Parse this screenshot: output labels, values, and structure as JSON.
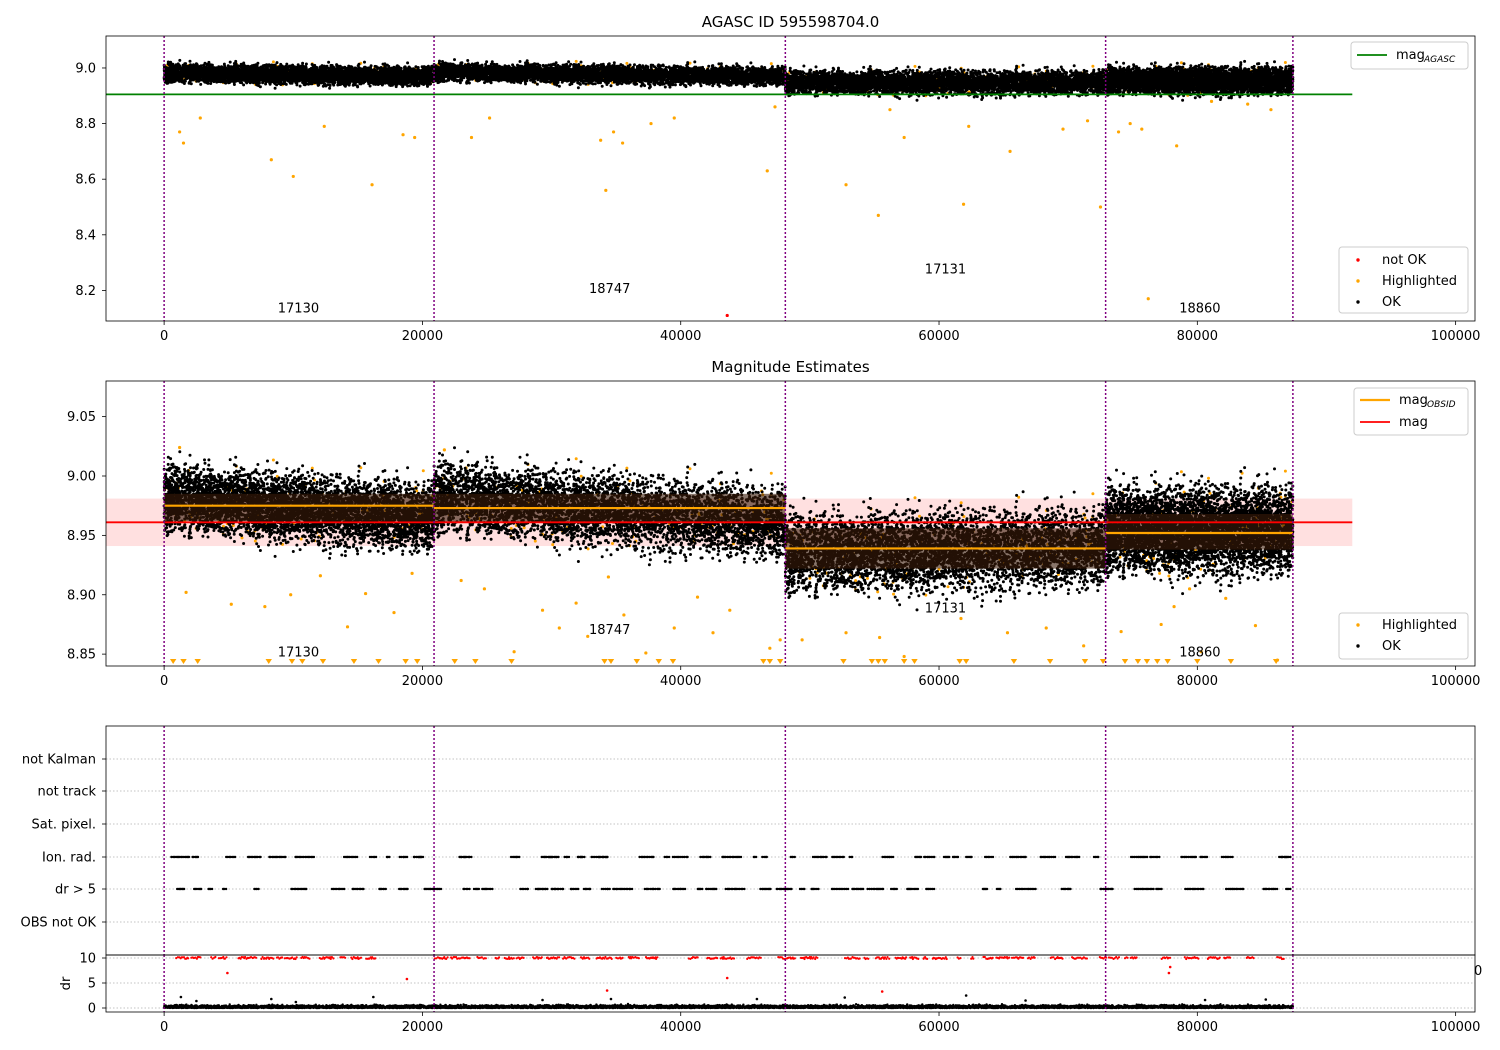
{
  "chart_data": [
    {
      "type": "scatter",
      "title": "AGASC ID 595598704.0",
      "xlim": [
        -4500,
        101500
      ],
      "ylim": [
        8.09,
        9.115
      ],
      "x_ticks": [
        0,
        20000,
        40000,
        60000,
        80000,
        100000
      ],
      "x_tick_labels": [
        "0",
        "20000",
        "40000",
        "60000",
        "80000",
        "100000"
      ],
      "y_ticks": [
        8.2,
        8.4,
        8.6,
        8.8,
        9.0
      ],
      "y_tick_labels": [
        "8.2",
        "8.4",
        "8.6",
        "8.8",
        "9.0"
      ],
      "obsid_boundaries": [
        0,
        20900,
        48100,
        72900,
        87400
      ],
      "obsid_labels": [
        {
          "text": "17130",
          "x": 10400,
          "y": 8.12
        },
        {
          "text": "18747",
          "x": 34500,
          "y": 8.19
        },
        {
          "text": "17131",
          "x": 60500,
          "y": 8.26
        },
        {
          "text": "18860",
          "x": 80200,
          "y": 8.12
        }
      ],
      "mag_agasc": 8.905,
      "mag_agasc_range": [
        -4500,
        92000
      ],
      "series_ok": [
        {
          "x": [
            0,
            20900
          ],
          "center": [
            8.982,
            8.97
          ],
          "spread": 0.035
        },
        {
          "x": [
            20900,
            48100
          ],
          "center": [
            8.985,
            8.97
          ],
          "spread": 0.035
        },
        {
          "x": [
            48100,
            72900
          ],
          "center": [
            8.948,
            8.948
          ],
          "spread": 0.045
        },
        {
          "x": [
            72900,
            87400
          ],
          "center": [
            8.955,
            8.955
          ],
          "spread": 0.05
        }
      ],
      "highlighted_outliers": [
        [
          1200,
          8.77
        ],
        [
          1500,
          8.73
        ],
        [
          2800,
          8.82
        ],
        [
          8300,
          8.67
        ],
        [
          10000,
          8.61
        ],
        [
          12400,
          8.79
        ],
        [
          16100,
          8.58
        ],
        [
          18500,
          8.76
        ],
        [
          19400,
          8.75
        ],
        [
          23800,
          8.75
        ],
        [
          25200,
          8.82
        ],
        [
          33800,
          8.74
        ],
        [
          34200,
          8.56
        ],
        [
          34800,
          8.77
        ],
        [
          35500,
          8.73
        ],
        [
          37700,
          8.8
        ],
        [
          39500,
          8.82
        ],
        [
          46700,
          8.63
        ],
        [
          47300,
          8.86
        ],
        [
          52800,
          8.58
        ],
        [
          55300,
          8.47
        ],
        [
          56200,
          8.85
        ],
        [
          57300,
          8.75
        ],
        [
          61900,
          8.51
        ],
        [
          62300,
          8.79
        ],
        [
          65500,
          8.7
        ],
        [
          69600,
          8.78
        ],
        [
          71500,
          8.81
        ],
        [
          72500,
          8.5
        ],
        [
          73900,
          8.77
        ],
        [
          74800,
          8.8
        ],
        [
          75700,
          8.78
        ],
        [
          76200,
          8.17
        ],
        [
          78400,
          8.72
        ],
        [
          81100,
          8.88
        ],
        [
          83900,
          8.87
        ],
        [
          85700,
          8.85
        ]
      ],
      "not_ok_points": [
        [
          43600,
          8.11
        ]
      ],
      "legend_top": [
        {
          "label_main": "mag",
          "label_sub": "AGASC",
          "color": "#008000"
        }
      ],
      "legend_bottom": [
        {
          "label": "not OK",
          "color": "#ff0000"
        },
        {
          "label": "Highlighted",
          "color": "#ffa500"
        },
        {
          "label": "OK",
          "color": "#000000"
        }
      ],
      "legend_position": "top-right / bottom-right"
    },
    {
      "type": "scatter",
      "title": "Magnitude Estimates",
      "xlim": [
        -4500,
        101500
      ],
      "ylim": [
        8.84,
        9.08
      ],
      "x_ticks": [
        0,
        20000,
        40000,
        60000,
        80000,
        100000
      ],
      "x_tick_labels": [
        "0",
        "20000",
        "40000",
        "60000",
        "80000",
        "100000"
      ],
      "y_ticks": [
        8.85,
        8.9,
        8.95,
        9.0,
        9.05
      ],
      "y_tick_labels": [
        "8.85",
        "8.90",
        "8.95",
        "9.00",
        "9.05"
      ],
      "obsid_boundaries": [
        0,
        20900,
        48100,
        72900,
        87400
      ],
      "obsid_labels": [
        {
          "text": "17130",
          "x": 10400,
          "y": 8.848
        },
        {
          "text": "18747",
          "x": 34500,
          "y": 8.867
        },
        {
          "text": "17131",
          "x": 60500,
          "y": 8.885
        },
        {
          "text": "18860",
          "x": 80200,
          "y": 8.848
        }
      ],
      "mag": 8.961,
      "mag_band": [
        8.941,
        8.981
      ],
      "mag_range": [
        -4500,
        92000
      ],
      "mag_obsid": [
        {
          "x": [
            0,
            20900
          ],
          "value": 8.975,
          "band": [
            8.962,
            8.985
          ]
        },
        {
          "x": [
            20900,
            48100
          ],
          "value": 8.973,
          "band": [
            8.961,
            8.985
          ]
        },
        {
          "x": [
            48100,
            72900
          ],
          "value": 8.939,
          "band": [
            8.922,
            8.956
          ]
        },
        {
          "x": [
            72900,
            87400
          ],
          "value": 8.952,
          "band": [
            8.938,
            8.968
          ]
        }
      ],
      "series_ok": [
        {
          "x": [
            0,
            20900
          ],
          "center": [
            8.982,
            8.965
          ],
          "spread": 0.03
        },
        {
          "x": [
            20900,
            48100
          ],
          "center": [
            8.983,
            8.96
          ],
          "spread": 0.032
        },
        {
          "x": [
            48100,
            72900
          ],
          "center": [
            8.935,
            8.94
          ],
          "spread": 0.035
        },
        {
          "x": [
            72900,
            87400
          ],
          "center": [
            8.955,
            8.955
          ],
          "spread": 0.038
        }
      ],
      "highlighted_outliers": [
        [
          1200,
          9.024
        ],
        [
          1700,
          8.902
        ],
        [
          5200,
          8.892
        ],
        [
          7800,
          8.89
        ],
        [
          9800,
          8.9
        ],
        [
          12100,
          8.916
        ],
        [
          14200,
          8.873
        ],
        [
          15600,
          8.901
        ],
        [
          17800,
          8.885
        ],
        [
          19200,
          8.918
        ],
        [
          21700,
          9.022
        ],
        [
          23000,
          8.912
        ],
        [
          24800,
          8.905
        ],
        [
          27100,
          8.852
        ],
        [
          29300,
          8.887
        ],
        [
          30600,
          8.872
        ],
        [
          31900,
          8.893
        ],
        [
          32800,
          8.865
        ],
        [
          34400,
          8.915
        ],
        [
          35600,
          8.883
        ],
        [
          37300,
          8.851
        ],
        [
          39500,
          8.872
        ],
        [
          41300,
          8.898
        ],
        [
          42500,
          8.868
        ],
        [
          43800,
          8.887
        ],
        [
          46900,
          8.855
        ],
        [
          47700,
          8.862
        ],
        [
          49400,
          8.862
        ],
        [
          52800,
          8.868
        ],
        [
          55400,
          8.864
        ],
        [
          57300,
          8.848
        ],
        [
          61700,
          8.88
        ],
        [
          65300,
          8.868
        ],
        [
          68300,
          8.872
        ],
        [
          71200,
          8.857
        ],
        [
          74100,
          8.869
        ],
        [
          77200,
          8.875
        ],
        [
          78200,
          8.89
        ],
        [
          79400,
          8.905
        ],
        [
          80300,
          8.852
        ],
        [
          82200,
          8.897
        ],
        [
          84500,
          8.874
        ],
        [
          86200,
          8.845
        ]
      ],
      "lower_limit_markers": [
        700,
        1500,
        2600,
        8100,
        9900,
        10700,
        12300,
        14700,
        16600,
        18700,
        19600,
        22500,
        24100,
        26900,
        34100,
        34600,
        36600,
        38300,
        39400,
        46400,
        46900,
        47700,
        52600,
        54800,
        55300,
        55800,
        57300,
        58100,
        61600,
        62100,
        65800,
        68600,
        71300,
        72700,
        74400,
        75400,
        76100,
        76900,
        77700,
        80000,
        82600,
        86100
      ],
      "legend_top": [
        {
          "label_main": "mag",
          "label_sub": "OBSID",
          "color": "#ffa500"
        },
        {
          "label_main": "mag",
          "label_sub": "",
          "color": "#ff0000"
        }
      ],
      "legend_bottom": [
        {
          "label": "Highlighted",
          "color": "#ffa500"
        },
        {
          "label": "OK",
          "color": "#000000"
        }
      ],
      "legend_position": "top-right / bottom-right"
    },
    {
      "type": "scatter",
      "title": "",
      "xlim": [
        -4500,
        101500
      ],
      "flag_rows": [
        "not Kalman",
        "not track",
        "Sat. pixel.",
        "Ion. rad.",
        "dr > 5",
        "OBS not OK"
      ],
      "flagged_rows": [
        "Ion. rad.",
        "dr > 5"
      ],
      "obsid_boundaries": [
        0,
        20900,
        48100,
        72900,
        87400
      ],
      "grid": true
    },
    {
      "type": "scatter",
      "title": "",
      "ylabel": "dr",
      "xlim": [
        -4500,
        101500
      ],
      "ylim": [
        -0.8,
        10.6
      ],
      "y_ticks": [
        0,
        5,
        10
      ],
      "y_tick_labels": [
        "0",
        "5",
        "10"
      ],
      "x_ticks": [
        0,
        20000,
        40000,
        60000,
        80000,
        100000
      ],
      "x_tick_labels": [
        "0",
        "20000",
        "40000",
        "60000",
        "80000",
        "100000"
      ],
      "clipped_value": 10,
      "red_points": [
        [
          4900,
          7.0
        ],
        [
          18800,
          5.8
        ],
        [
          43600,
          6.0
        ],
        [
          34300,
          3.5
        ],
        [
          55600,
          3.3
        ],
        [
          77800,
          7.0
        ],
        [
          77900,
          8.2
        ]
      ],
      "scattered_black_points": [
        [
          1300,
          2.2
        ],
        [
          2500,
          1.4
        ],
        [
          8300,
          1.8
        ],
        [
          10200,
          1.2
        ],
        [
          16200,
          2.2
        ],
        [
          29300,
          1.6
        ],
        [
          34600,
          1.8
        ],
        [
          45900,
          1.8
        ],
        [
          52700,
          2.1
        ],
        [
          62100,
          2.5
        ],
        [
          66700,
          1.5
        ],
        [
          80600,
          1.6
        ],
        [
          85300,
          1.7
        ]
      ],
      "obsid_boundaries": [
        0,
        20900,
        48100,
        72900,
        87400
      ],
      "grid": true,
      "stray_tick_label": "0"
    }
  ]
}
